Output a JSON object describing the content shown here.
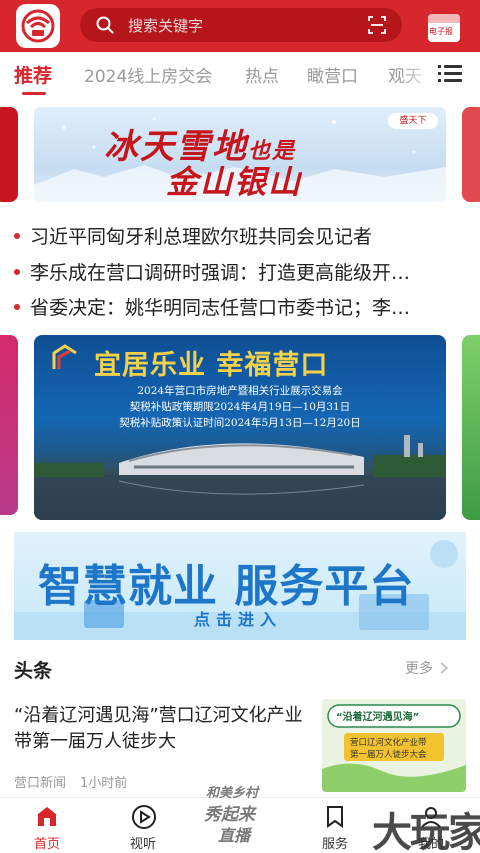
{
  "header": {
    "search_placeholder": "搜索关键字",
    "epaper_label": "电子报",
    "brand_color": "#d8262d"
  },
  "tabs": [
    {
      "label": "推荐",
      "active": true
    },
    {
      "label": "2024线上房交会",
      "active": false
    },
    {
      "label": "热点",
      "active": false
    },
    {
      "label": "瞰营口",
      "active": false
    },
    {
      "label": "观天",
      "active": false
    }
  ],
  "banner_top": {
    "line1_a": "冰天雪地",
    "line1_b": "也是",
    "line2": "金山银山",
    "badge": "盛天下"
  },
  "news": [
    "习近平同匈牙利总理欧尔班共同会见记者",
    "李乐成在营口调研时强调：打造更高能级开…",
    "省委决定：姚华明同志任营口市委书记；李…"
  ],
  "banner_mid": {
    "title": "宜居乐业  幸福营口",
    "line1": "2024年营口市房地产暨相关行业展示交易会",
    "line2": "契税补贴政策期限2024年4月19日—10月31日",
    "line3": "契税补贴政策认证时间2024年5月13日—12月20日"
  },
  "banner_bottom": {
    "title": "智慧就业 服务平台",
    "cta": "点击进入"
  },
  "section": {
    "title": "头条",
    "more": "更多"
  },
  "headline": {
    "title": "“沿着辽河遇见海”营口辽河文化产业带第一届万人徒步大",
    "source": "营口新闻",
    "time": "1小时前",
    "thumb_title": "“沿着辽河遇见海”",
    "thumb_sub1": "营口辽河文化产业带",
    "thumb_sub2": "第一届万人徒步大会"
  },
  "bottom_nav": [
    {
      "label": "首页",
      "icon": "home-icon",
      "active": true
    },
    {
      "label": "视听",
      "icon": "play-icon",
      "active": false
    },
    {
      "label": "服务",
      "icon": "bookmark-icon",
      "active": false
    },
    {
      "label": "我的",
      "icon": "user-icon",
      "active": false
    }
  ],
  "center_stamp": {
    "line1": "和美乡村",
    "line2": "秀起来",
    "line3": "直播"
  },
  "watermark": "大玩家"
}
